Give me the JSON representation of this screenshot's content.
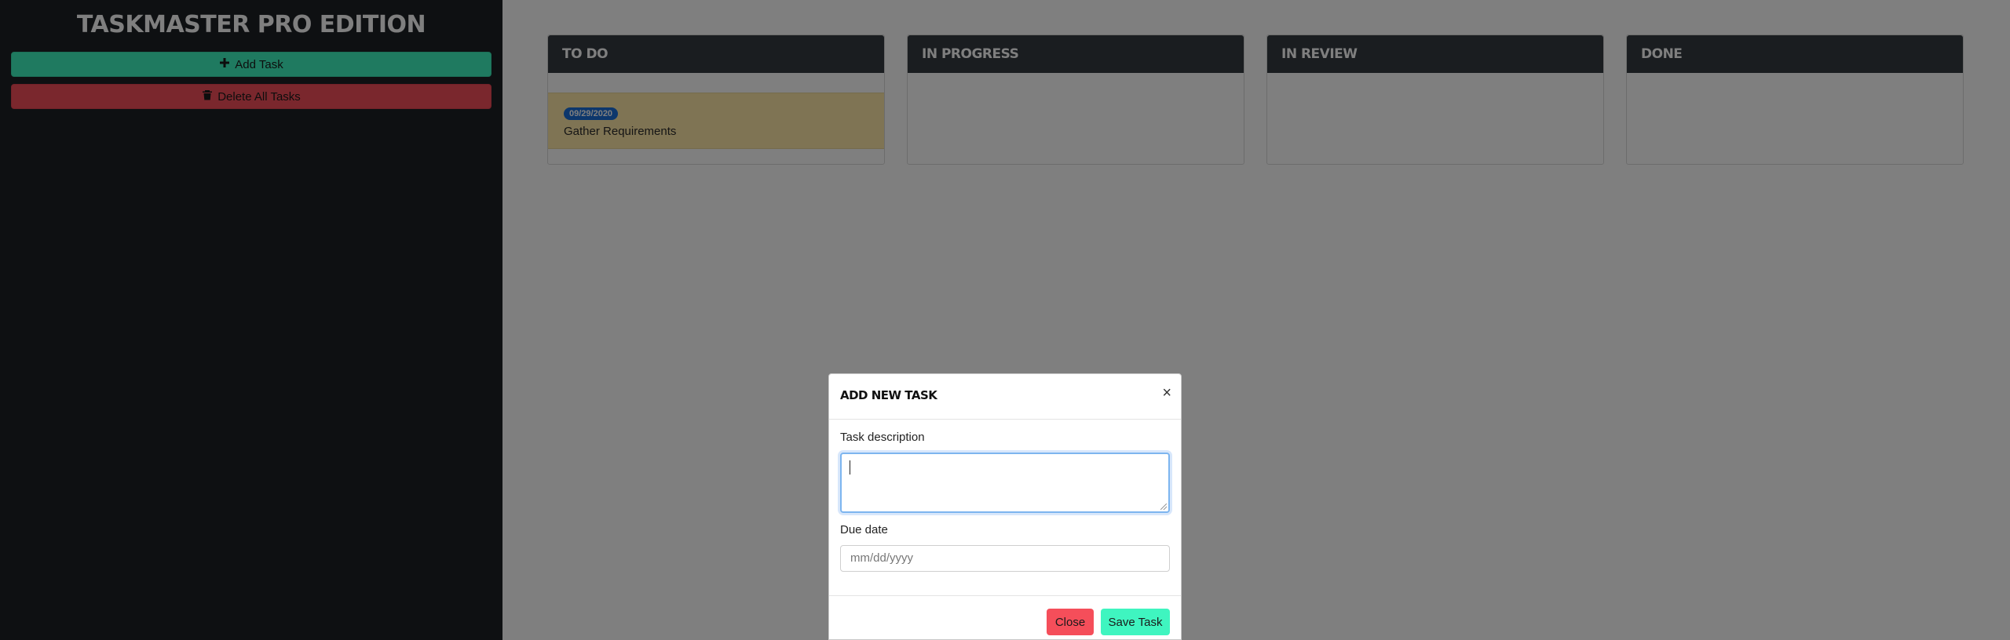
{
  "app": {
    "title": "TASKMASTER PRO EDITION"
  },
  "sidebar": {
    "add_task_label": "Add Task",
    "delete_all_label": "Delete All Tasks"
  },
  "board": {
    "columns": [
      {
        "title": "TO DO"
      },
      {
        "title": "IN PROGRESS"
      },
      {
        "title": "IN REVIEW"
      },
      {
        "title": "DONE"
      }
    ],
    "tasks": [
      {
        "column": "TO DO",
        "due": "09/29/2020",
        "text": "Gather Requirements"
      }
    ]
  },
  "modal": {
    "title": "ADD NEW TASK",
    "close_glyph": "×",
    "description_label": "Task description",
    "description_value": "",
    "due_label": "Due date",
    "due_placeholder": "mm/dd/yyyy",
    "close_label": "Close",
    "save_label": "Save Task"
  },
  "colors": {
    "sidebar_bg": "#1d2125",
    "add_button": "#3ff5c0",
    "delete_button": "#f54e5a",
    "column_header": "#343a40",
    "task_card": "#ffe8a8",
    "badge": "#1a6fd8"
  }
}
